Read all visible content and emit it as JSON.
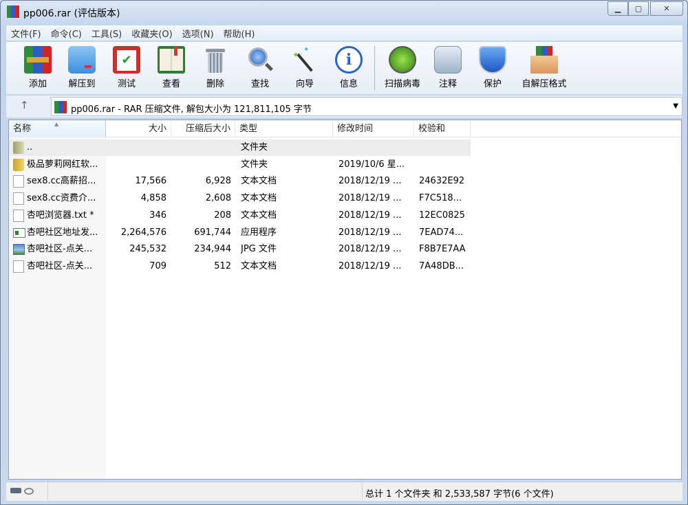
{
  "window": {
    "title": "pp006.rar (评估版本)",
    "minimize": "▁",
    "maximize": "▢",
    "close": "✕"
  },
  "menu": [
    "文件(F)",
    "命令(C)",
    "工具(S)",
    "收藏夹(O)",
    "选项(N)",
    "帮助(H)"
  ],
  "toolbar": [
    {
      "label": "添加",
      "icon": "add-archive-icon"
    },
    {
      "label": "解压到",
      "icon": "extract-folder-icon"
    },
    {
      "label": "测试",
      "icon": "test-clipboard-icon"
    },
    {
      "label": "查看",
      "icon": "view-book-icon"
    },
    {
      "label": "删除",
      "icon": "trash-icon"
    },
    {
      "label": "查找",
      "icon": "magnifier-icon"
    },
    {
      "label": "向导",
      "icon": "wizard-wand-icon"
    },
    {
      "label": "信息",
      "icon": "info-icon"
    },
    {
      "label": "扫描病毒",
      "icon": "virus-scan-icon"
    },
    {
      "label": "注释",
      "icon": "comment-icon"
    },
    {
      "label": "保护",
      "icon": "shield-icon"
    },
    {
      "label": "自解压格式",
      "icon": "sfx-box-icon"
    }
  ],
  "address": {
    "up": "↑",
    "text": "pp006.rar - RAR 压缩文件, 解包大小为 121,811,105 字节",
    "dropdown": "▼"
  },
  "columns": {
    "name": "名称",
    "size": "大小",
    "packed": "压缩后大小",
    "type": "类型",
    "modified": "修改时间",
    "crc": "校验和",
    "sort_arrow": "▲"
  },
  "files": [
    {
      "name": "..",
      "size": "",
      "packed": "",
      "type": "文件夹",
      "modified": "",
      "crc": "",
      "kind": "up"
    },
    {
      "name": "极品萝莉网红软...",
      "size": "",
      "packed": "",
      "type": "文件夹",
      "modified": "2019/10/6 星...",
      "crc": "",
      "kind": "folder"
    },
    {
      "name": "sex8.cc高薪招...",
      "size": "17,566",
      "packed": "6,928",
      "type": "文本文档",
      "modified": "2018/12/19 ...",
      "crc": "24632E92",
      "kind": "txt"
    },
    {
      "name": "sex8.cc资费介...",
      "size": "4,858",
      "packed": "2,608",
      "type": "文本文档",
      "modified": "2018/12/19 ...",
      "crc": "F7C518...",
      "kind": "txt"
    },
    {
      "name": "杏吧浏览器.txt *",
      "size": "346",
      "packed": "208",
      "type": "文本文档",
      "modified": "2018/12/19 ...",
      "crc": "12EC0825",
      "kind": "txt"
    },
    {
      "name": "杏吧社区地址发...",
      "size": "2,264,576",
      "packed": "691,744",
      "type": "应用程序",
      "modified": "2018/12/19 ...",
      "crc": "7EAD74...",
      "kind": "exe"
    },
    {
      "name": "杏吧社区-点关...",
      "size": "245,532",
      "packed": "234,944",
      "type": "JPG 文件",
      "modified": "2018/12/19 ...",
      "crc": "F8B7E7AA",
      "kind": "jpg"
    },
    {
      "name": "杏吧社区-点关...",
      "size": "709",
      "packed": "512",
      "type": "文本文档",
      "modified": "2018/12/19 ...",
      "crc": "7A48DB...",
      "kind": "txt"
    }
  ],
  "status": {
    "summary": "总计 1 个文件夹 和 2,533,587 字节(6 个文件)"
  }
}
